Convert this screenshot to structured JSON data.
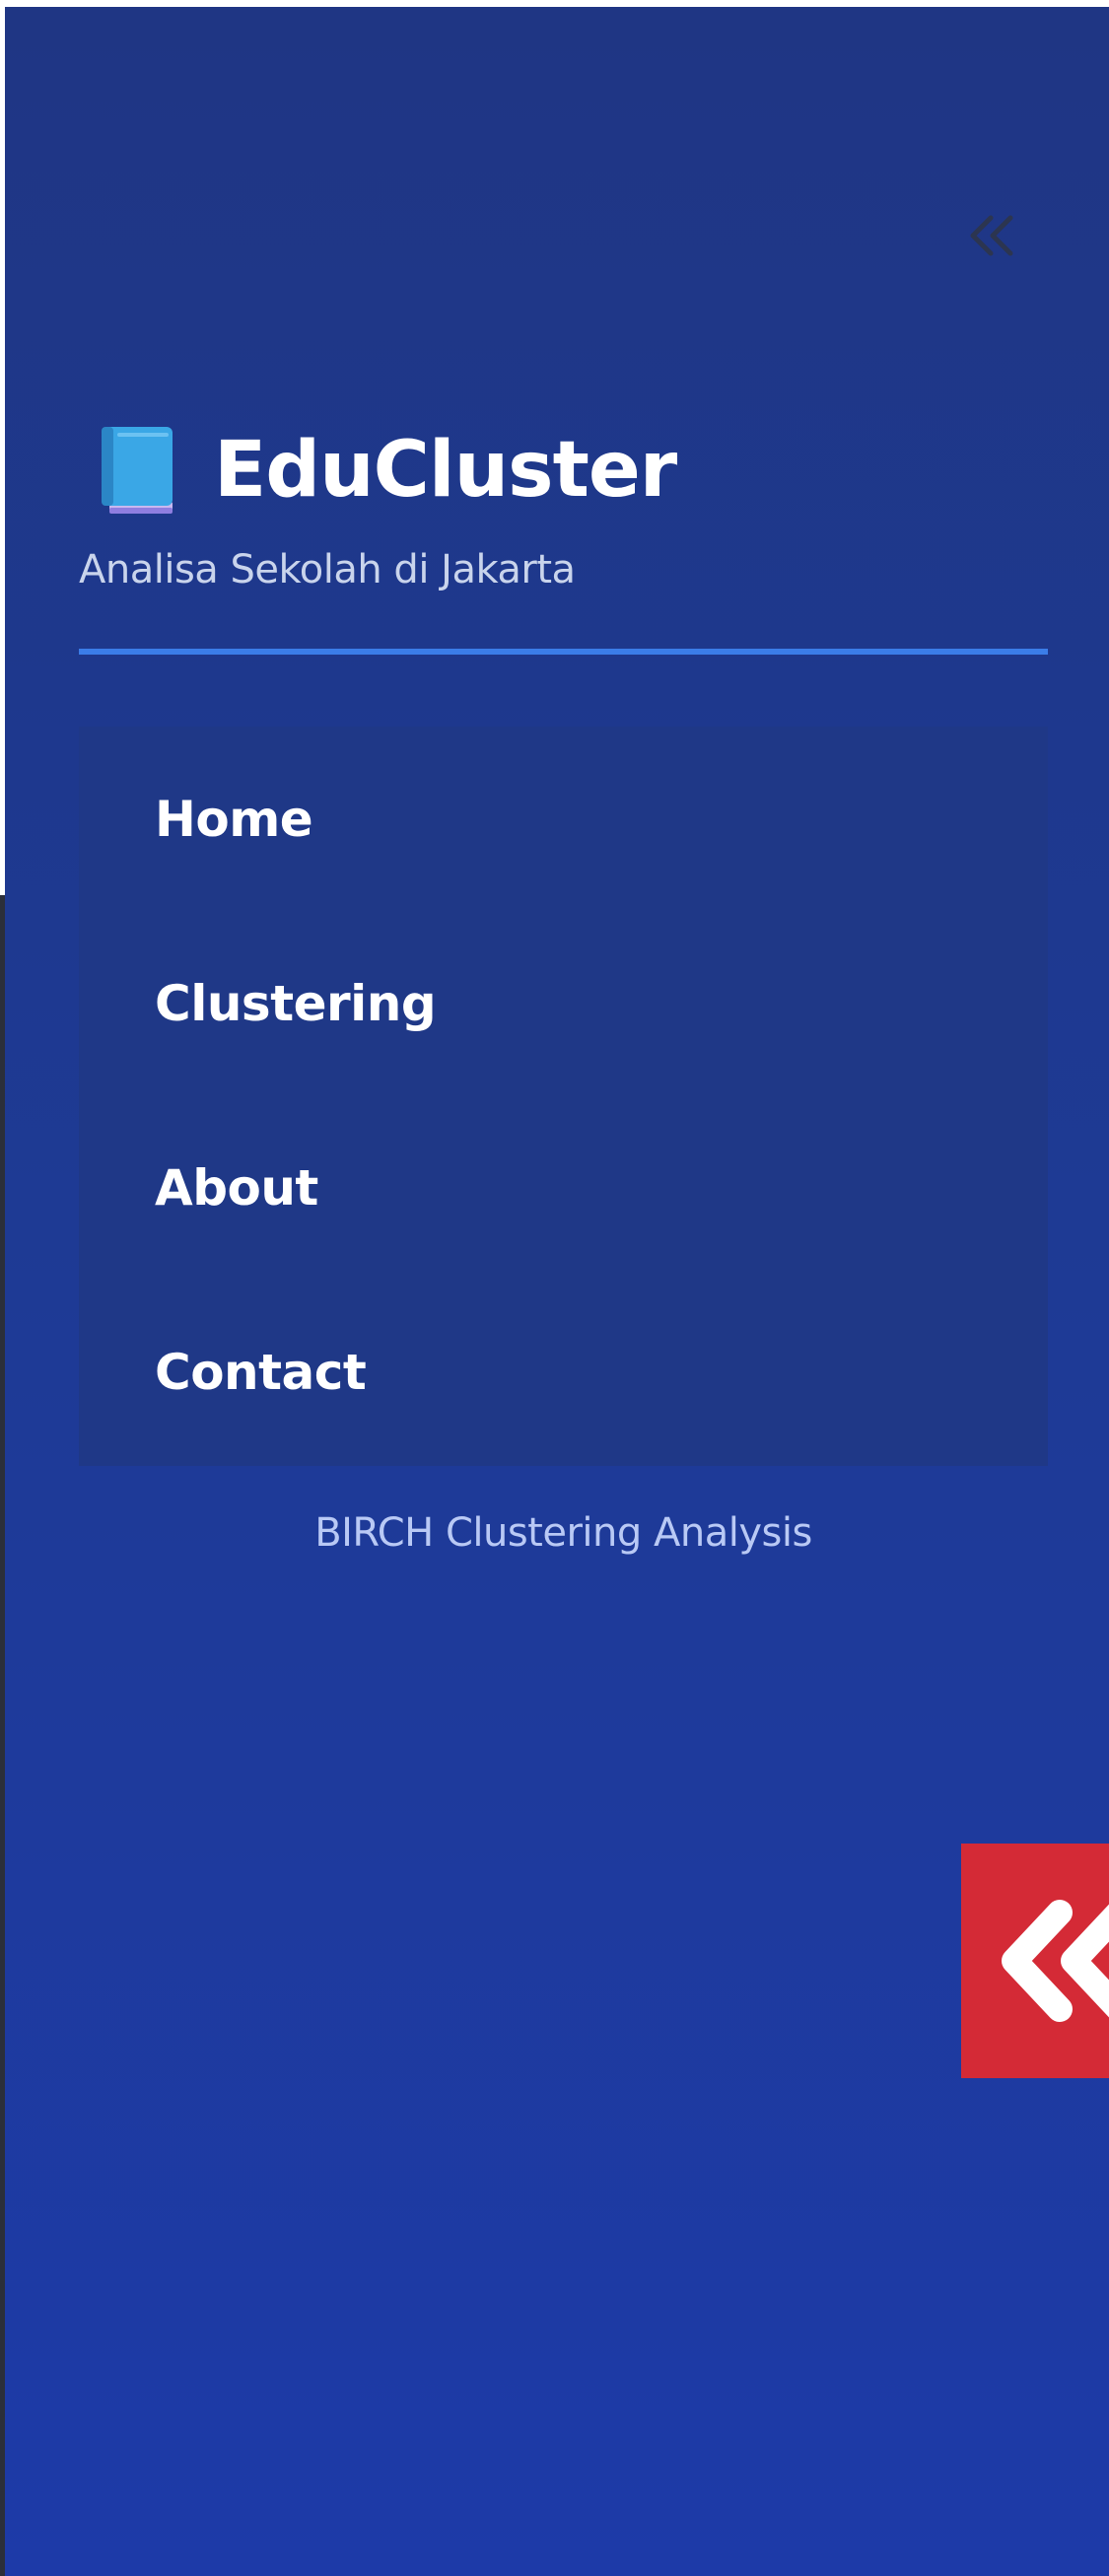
{
  "app": {
    "title": "EduCluster",
    "subtitle": "Analisa Sekolah di Jakarta"
  },
  "sidebar": {
    "collapse_icon": "double-chevron-left-icon",
    "brand_icon": "blue-book-icon",
    "menu": [
      {
        "label": "Home"
      },
      {
        "label": "Clustering"
      },
      {
        "label": "About"
      },
      {
        "label": "Contact"
      }
    ],
    "footer": "BIRCH Clustering Analysis"
  },
  "expand_button": {
    "icon": "double-chevron-left-icon"
  },
  "colors": {
    "sidebar_top": "#1f3684",
    "sidebar_bottom": "#1d3aa8",
    "divider": "#3b7de8",
    "menu_bg": "#1f3887",
    "expand_button_bg": "#d42a36"
  }
}
